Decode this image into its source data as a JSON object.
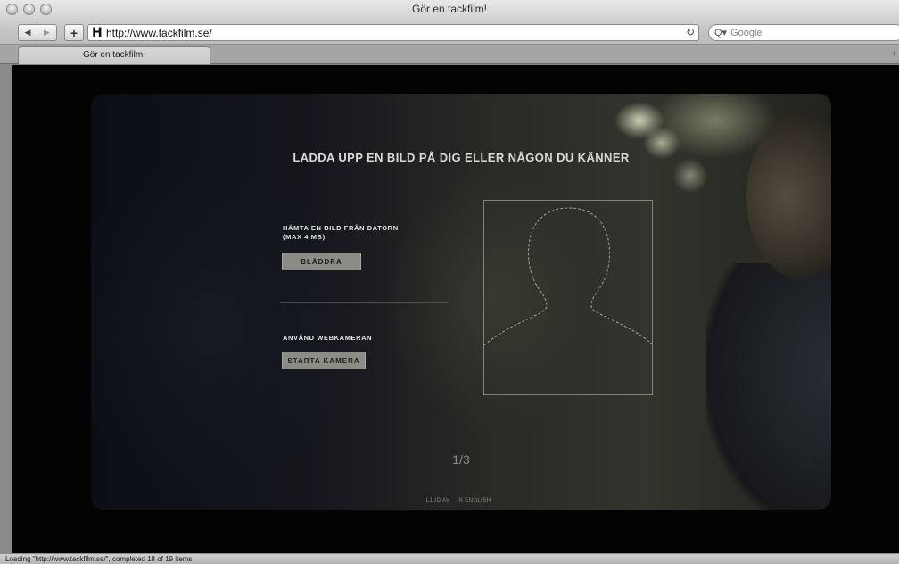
{
  "window": {
    "title": "Gör en tackfilm!"
  },
  "toolbar": {
    "back_glyph": "◀",
    "forward_glyph": "▶",
    "add_glyph": "+",
    "favicon_glyph": "H",
    "url": "http://www.tackfilm.se/",
    "reload_glyph": "↻",
    "search_glyph": "Q▾",
    "search_placeholder": "Google"
  },
  "tabs": [
    {
      "label": "Gör en tackfilm!"
    }
  ],
  "tabbar": {
    "new_tab_glyph": "+"
  },
  "page": {
    "headline": "LADDA UPP EN BILD PÅ DIG ELLER NÅGON DU KÄNNER",
    "upload": {
      "label_line1": "HÄMTA EN BILD FRÅN DATORN",
      "label_line2": "(MAX 4 MB)",
      "button": "BLÄDDRA"
    },
    "webcam": {
      "label": "ANVÄND WEBKAMERAN",
      "button": "STARTA KAMERA"
    },
    "pager": "1/3",
    "footer": {
      "sound": "LJUD AV",
      "english": "IN ENGLISH"
    }
  },
  "status": "Loading \"http://www.tackfilm.se/\", completed 18 of 19 items"
}
